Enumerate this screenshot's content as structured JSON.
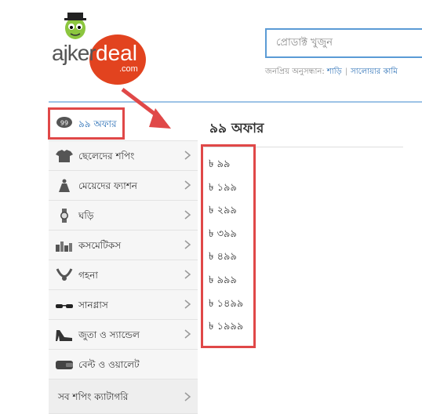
{
  "logo": {
    "ajker": "ajker",
    "deal": "deal",
    "com": ".com"
  },
  "search": {
    "placeholder": "প্রোডাক্ট খুজুন"
  },
  "popular": {
    "label": "জনপ্রিয় অনুসন্ধান:",
    "links": [
      "শাড়ি",
      "সালোয়ার কামি"
    ]
  },
  "sidebar": {
    "items": [
      {
        "label": "৯৯ অফার",
        "icon": "badge-99-icon"
      },
      {
        "label": "ছেলেদের শপিং",
        "icon": "tshirt-icon"
      },
      {
        "label": "মেয়েদের ফ্যাশন",
        "icon": "dress-icon"
      },
      {
        "label": "ঘড়ি",
        "icon": "watch-icon"
      },
      {
        "label": "কসমেটিকস",
        "icon": "cosmetics-icon"
      },
      {
        "label": "গহনা",
        "icon": "necklace-icon"
      },
      {
        "label": "সানগ্লাস",
        "icon": "sunglasses-icon"
      },
      {
        "label": "জুতা ও স্যান্ডেল",
        "icon": "heel-shoe-icon"
      },
      {
        "label": "বেল্ট ও ওয়ালেট",
        "icon": "wallet-icon"
      }
    ],
    "all_categories": "সব শপিং ক্যাটাগরি"
  },
  "main": {
    "title": "৯৯ অফার",
    "offers": [
      "৳ ৯৯",
      "৳ ১৯৯",
      "৳ ২৯৯",
      "৳ ৩৯৯",
      "৳ ৪৯৯",
      "৳ ৯৯৯",
      "৳ ১৪৯৯",
      "৳ ১৯৯৯"
    ]
  },
  "colors": {
    "accent": "#2a6fb6",
    "highlight": "#e04848",
    "logo_red": "#e2431f",
    "search_border": "#5b9bd5"
  }
}
